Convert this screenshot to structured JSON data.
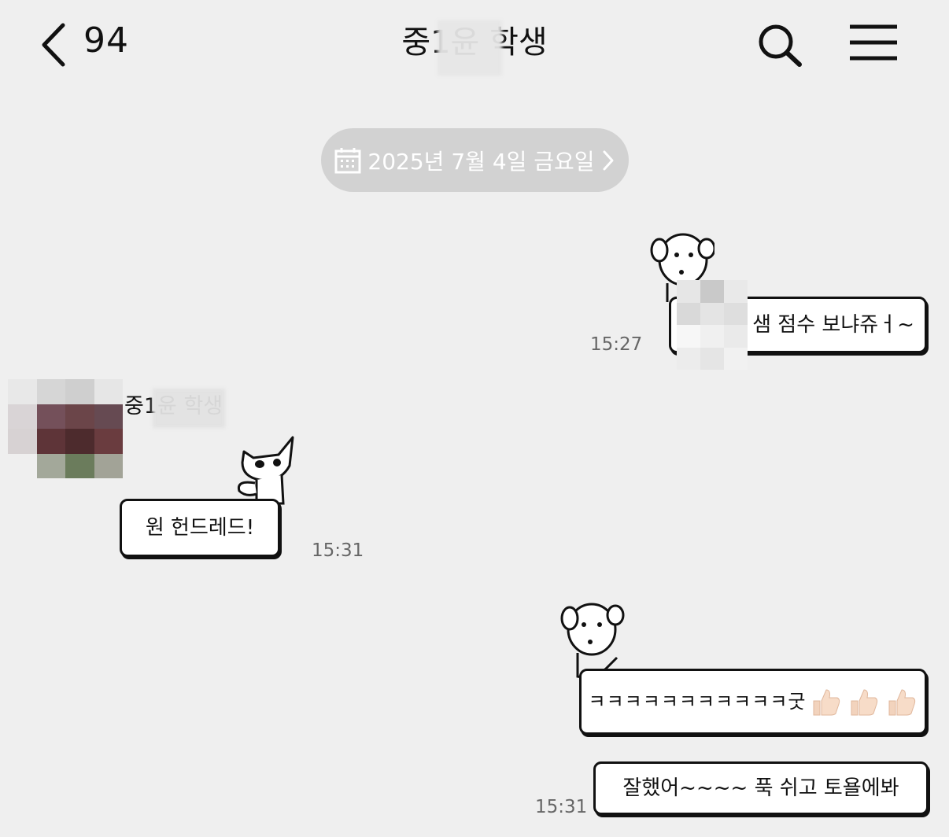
{
  "header": {
    "back_icon": "chevron-left-icon",
    "unread_count": "94",
    "title": "중1윤     학생",
    "search_icon": "search-icon",
    "menu_icon": "hamburger-menu-icon"
  },
  "date_divider": {
    "icon": "calendar-icon",
    "label": "2025년 7월 4일 금요일",
    "chevron_icon": "chevron-right-icon"
  },
  "messages": [
    {
      "side": "outgoing",
      "text": "샘 점수 보냐쥬ㅓ~",
      "time": "15:27",
      "sticker": "puppy-sticker"
    },
    {
      "side": "incoming",
      "sender": "중1윤     학생",
      "text": "원 헌드레드!",
      "time": "15:31",
      "sticker": "cat-sticker"
    },
    {
      "side": "outgoing",
      "text": "ㅋㅋㅋㅋㅋㅋㅋㅋㅋㅋㅋ굿",
      "emoji": "thumbs-up-icon",
      "emoji_count": 3,
      "sticker": "puppy-sticker"
    },
    {
      "side": "outgoing",
      "text": "잘했어~~~~ 푹 쉬고 토욜에봐",
      "time": "15:31"
    }
  ],
  "colors": {
    "background": "#efefef",
    "date_pill": "#d2d2d2",
    "bubble_border": "#111111",
    "timestamp": "#666666"
  }
}
